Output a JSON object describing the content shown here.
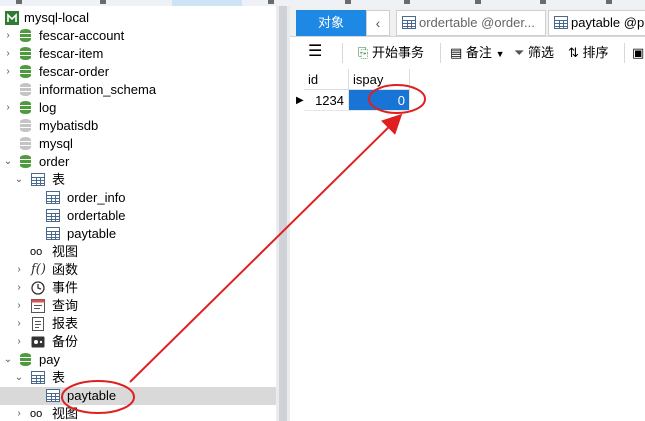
{
  "tree": {
    "connection": "mysql-local",
    "databases": [
      {
        "name": "fescar-account",
        "open": true
      },
      {
        "name": "fescar-item",
        "open": true
      },
      {
        "name": "fescar-order",
        "open": true
      },
      {
        "name": "information_schema",
        "open": false
      },
      {
        "name": "log",
        "open": true
      },
      {
        "name": "mybatisdb",
        "open": false
      },
      {
        "name": "mysql",
        "open": false
      }
    ],
    "order_db": {
      "name": "order",
      "tables_label": "表",
      "tables": [
        "order_info",
        "ordertable",
        "paytable"
      ],
      "views": "视图",
      "functions": "函数",
      "events": "事件",
      "queries": "查询",
      "reports": "报表",
      "backups": "备份"
    },
    "pay_db": {
      "name": "pay",
      "tables_label": "表",
      "tables": [
        "paytable"
      ],
      "views": "视图"
    }
  },
  "tabs": {
    "objects": "对象",
    "back": "‹",
    "tab1": "ordertable @order...",
    "tab2": "paytable @p"
  },
  "toolbar": {
    "begin_transaction": "开始事务",
    "notes": "备注",
    "filter": "筛选",
    "sort": "排序"
  },
  "grid": {
    "columns": [
      "id",
      "ispay"
    ],
    "rows": [
      [
        "1234",
        "0"
      ]
    ]
  },
  "colors": {
    "accent": "#1e88e5",
    "db_green": "#4f9a3f",
    "annotation_red": "#e02020"
  }
}
